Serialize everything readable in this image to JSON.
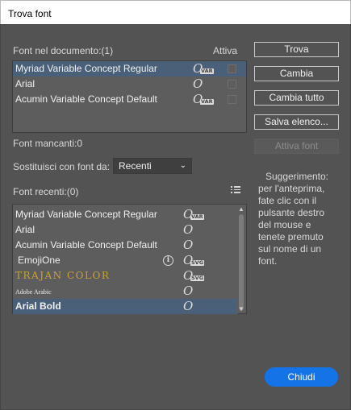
{
  "window": {
    "title": "Trova font"
  },
  "document_fonts": {
    "header": "Font nel documento:(1)",
    "active_header": "Attiva",
    "items": [
      {
        "name": "Myriad Variable Concept Regular",
        "icon": "variable-font-icon",
        "badge": "VAR",
        "selected": true
      },
      {
        "name": "Arial",
        "icon": "opentype-font-icon",
        "badge": "",
        "selected": false
      },
      {
        "name": "Acumin Variable Concept Default",
        "icon": "variable-font-icon",
        "badge": "VAR",
        "selected": false
      }
    ]
  },
  "missing_fonts": {
    "label": "Font mancanti:0"
  },
  "replace": {
    "label": "Sostituisci con font da:",
    "selected": "Recenti"
  },
  "recent_fonts": {
    "header": "Font recenti:(0)",
    "items": [
      {
        "name": "Myriad Variable Concept Regular",
        "badge": "VAR",
        "info": false,
        "selected": false,
        "style": "normal"
      },
      {
        "name": "Arial",
        "badge": "",
        "info": false,
        "selected": false,
        "style": "normal"
      },
      {
        "name": "Acumin Variable Concept Default",
        "badge": "",
        "info": false,
        "selected": false,
        "style": "normal"
      },
      {
        "name": "EmojiOne",
        "badge": "SVG",
        "info": true,
        "selected": false,
        "style": "normal"
      },
      {
        "name": "TRAJAN COLOR",
        "badge": "SVG",
        "info": false,
        "selected": false,
        "style": "trajan"
      },
      {
        "name": "Adobe Arabic",
        "badge": "",
        "info": false,
        "selected": false,
        "style": "small-serif"
      },
      {
        "name": "Arial Bold",
        "badge": "",
        "info": false,
        "selected": true,
        "style": "bold"
      }
    ]
  },
  "buttons": {
    "trova": "Trova",
    "cambia": "Cambia",
    "cambia_tutto": "Cambia tutto",
    "salva_elenco": "Salva elenco...",
    "attiva_font": "Attiva font",
    "chiudi": "Chiudi"
  },
  "hint": {
    "title": "Suggerimento:",
    "body": "per l'anteprima, fate clic con il pulsante destro del mouse e tenete premuto sul nome di un font."
  },
  "colors": {
    "accent": "#1473e6",
    "selection": "#4a6079",
    "panel": "#535353"
  }
}
